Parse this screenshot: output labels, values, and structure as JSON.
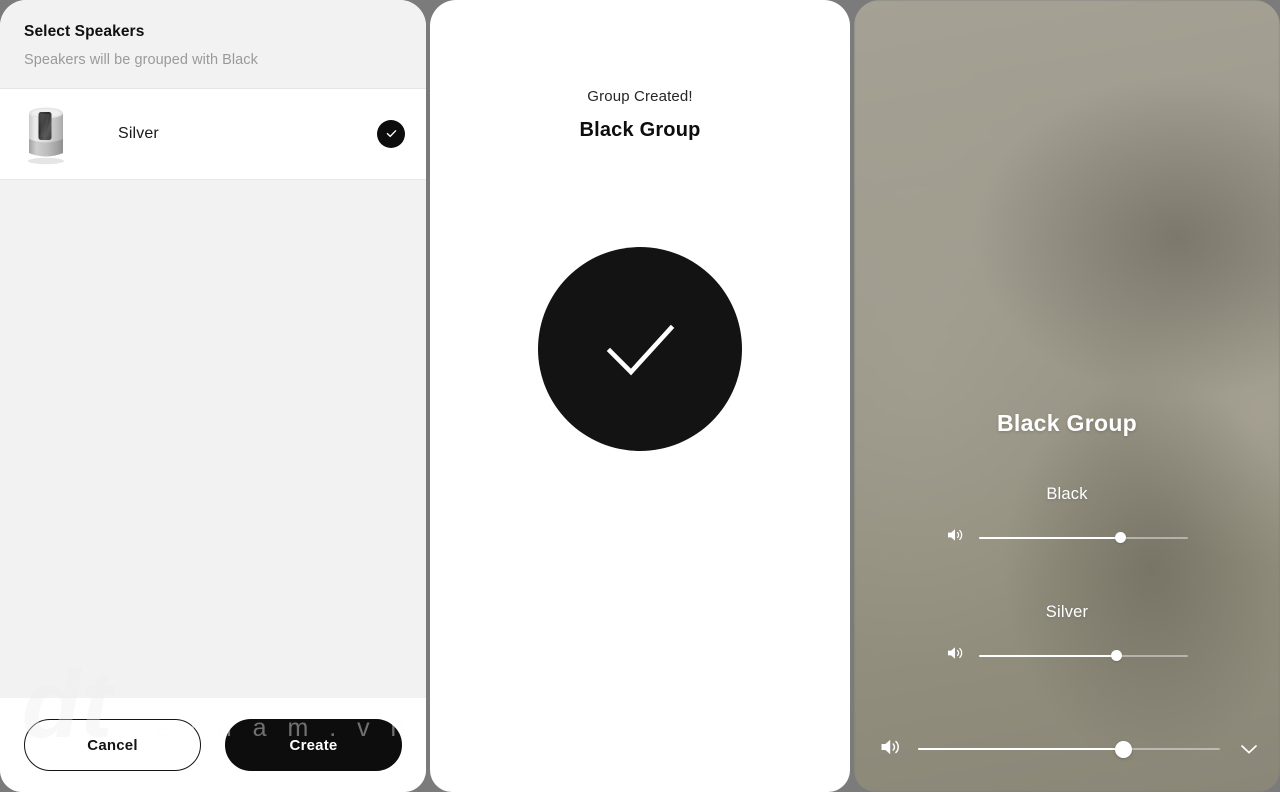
{
  "select_speakers_sheet": {
    "title": "Select Speakers",
    "subtitle": "Speakers will be grouped with Black",
    "speakers": [
      {
        "name": "Silver",
        "selected": true,
        "thumb_icon": "cylindrical-speaker-icon",
        "check_icon": "check-icon"
      }
    ],
    "footer": {
      "cancel_label": "Cancel",
      "create_label": "Create"
    }
  },
  "watermark": {
    "logo": "dt",
    "text": "e t n a m . v n"
  },
  "group_created_panel": {
    "status_text": "Group Created!",
    "group_name": "Black Group",
    "success_icon": "check-circle-icon"
  },
  "now_playing_panel": {
    "group_title": "Black Group",
    "speakers": [
      {
        "name": "Black",
        "volume_percent": 68,
        "volume_icon": "volume-icon"
      },
      {
        "name": "Silver",
        "volume_percent": 66,
        "volume_icon": "volume-icon"
      }
    ],
    "master": {
      "volume_percent": 68,
      "volume_icon": "volume-icon",
      "collapse_icon": "chevron-down-icon"
    }
  },
  "colors": {
    "accent_dark": "#0d0d0d",
    "sheet_header_bg": "#f2f2f2",
    "panel_bg": "#ffffff",
    "app_backdrop": "#7b7b7b",
    "now_playing_bg": "#9d9a8c",
    "slider_fill": "#ffffff"
  }
}
